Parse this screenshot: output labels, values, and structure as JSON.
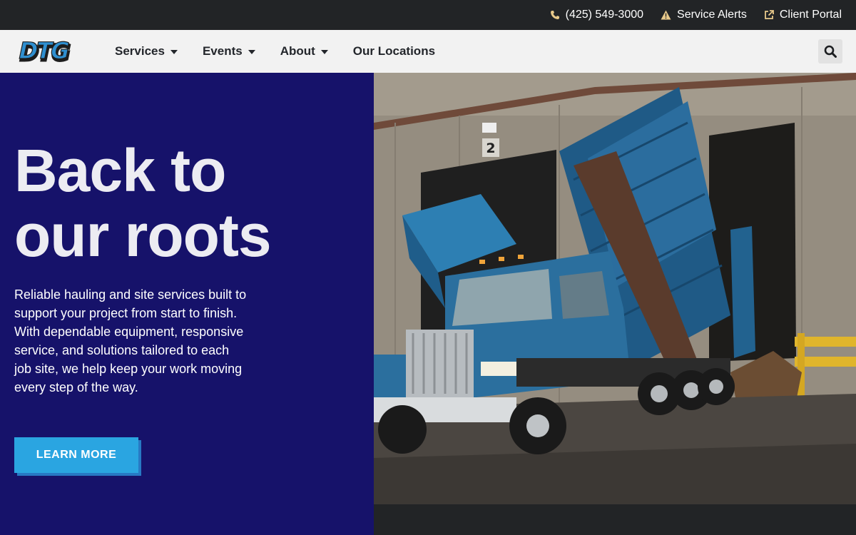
{
  "topbar": {
    "phone": {
      "icon": "phone-icon",
      "label": "(425) 549-3000"
    },
    "alerts": {
      "icon": "warning-icon",
      "label": "Service Alerts"
    },
    "portal": {
      "icon": "external-link-icon",
      "label": "Client Portal"
    }
  },
  "nav": {
    "logo_text": "DTG",
    "items": [
      {
        "label": "Services",
        "has_dropdown": true
      },
      {
        "label": "Events",
        "has_dropdown": true
      },
      {
        "label": "About",
        "has_dropdown": true
      },
      {
        "label": "Our Locations",
        "has_dropdown": false
      }
    ],
    "search_icon": "search-icon"
  },
  "hero": {
    "headline_line1": "Back to",
    "headline_line2": "our roots",
    "description": "Reliable hauling and site services built to support your project from start to finish. With dependable equipment, responsive service, and solutions tailored to each job site, we help keep your work moving every step of the way.",
    "cta_label": "LEARN MORE",
    "photo_door_number": "2"
  },
  "colors": {
    "topbar_bg": "#222426",
    "nav_bg": "#f2f2f2",
    "hero_bg": "#16126a",
    "cta_bg": "#2aa5e1",
    "cta_shadow": "#2779c4",
    "accent_icon": "#e8c98a"
  }
}
